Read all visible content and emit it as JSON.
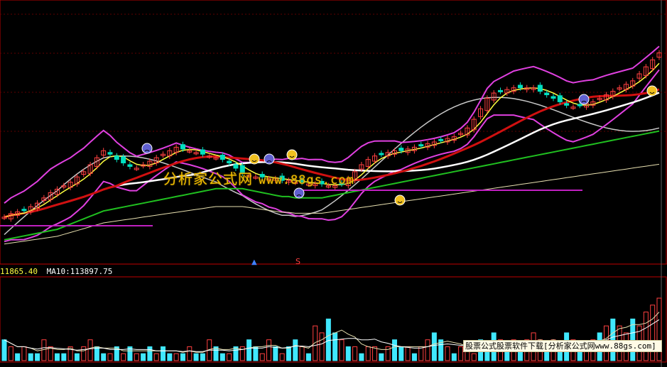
{
  "colors": {
    "background": "#000000",
    "panel_border": "#c00000",
    "up_candle": "#ff4040",
    "down_candle": "#00e0c0",
    "volume_up": "#ff4040",
    "volume_down": "#40e8ff",
    "ma_white": "#ffffff",
    "ma_yellow": "#ffff40",
    "ma_red": "#d01010",
    "ma_green": "#20c020",
    "ma_pale": "#e8e0b0",
    "band_magenta": "#e040e0",
    "band_gray": "#c8c8c8",
    "signal_line": "#c020c0"
  },
  "volume_header": {
    "ma5_text": "11865.40",
    "ma10_text": "MA10:113897.75",
    "ma5_color": "#ffff40",
    "ma10_color": "#ffffff"
  },
  "watermark": {
    "center_text": "分析家公式网",
    "center_url": "www.88gs.com",
    "footer_text": "股票公式股票软件下载[分析家公式网www.88gs.com]"
  },
  "signals": {
    "up_arrow_symbol": "▲",
    "s_mark": "S"
  },
  "icons": [
    "sad-face-icon",
    "smile-face-icon"
  ],
  "chart_data": [
    {
      "type": "candlestick",
      "title": "",
      "xlabel": "",
      "ylabel": "",
      "grid": true,
      "x": [
        1,
        2,
        3,
        4,
        5,
        6,
        7,
        8,
        9,
        10,
        11,
        12,
        13,
        14,
        15,
        16,
        17,
        18,
        19,
        20,
        21,
        22,
        23,
        24,
        25,
        26,
        27,
        28,
        29,
        30,
        31,
        32,
        33,
        34,
        35,
        36,
        37,
        38,
        39,
        40,
        41,
        42,
        43,
        44,
        45,
        46,
        47,
        48,
        49,
        50,
        51,
        52,
        53,
        54,
        55,
        56,
        57,
        58,
        59,
        60,
        61,
        62,
        63,
        64,
        65,
        66,
        67,
        68,
        69,
        70,
        71,
        72,
        73,
        74,
        75,
        76,
        77,
        78,
        79,
        80,
        81,
        82,
        83,
        84,
        85,
        86,
        87,
        88,
        89,
        90,
        91,
        92,
        93,
        94,
        95,
        96,
        97,
        98,
        99,
        100
      ],
      "close": [
        22,
        24,
        25,
        26,
        28,
        30,
        33,
        36,
        38,
        40,
        42,
        45,
        48,
        52,
        56,
        60,
        58,
        55,
        53,
        51,
        50,
        52,
        54,
        56,
        58,
        60,
        62,
        61,
        60,
        59,
        58,
        57,
        56,
        55,
        53,
        50,
        47,
        46,
        45,
        45,
        44,
        44,
        43,
        43,
        42,
        42,
        41,
        41,
        41,
        40,
        40,
        41,
        44,
        48,
        52,
        55,
        57,
        58,
        59,
        60,
        60,
        61,
        62,
        63,
        64,
        65,
        66,
        67,
        68,
        70,
        73,
        78,
        84,
        90,
        93,
        94,
        95,
        96,
        96,
        96,
        96,
        94,
        92,
        90,
        88,
        86,
        85,
        86,
        87,
        88,
        90,
        92,
        94,
        96,
        98,
        100,
        104,
        108,
        112,
        116
      ],
      "series": [
        {
          "name": "",
          "values": [
            12,
            13,
            14,
            15,
            16,
            17,
            18,
            19,
            20,
            22,
            24,
            26,
            28,
            30,
            32,
            34,
            35,
            36,
            37,
            38,
            39,
            40,
            41,
            42,
            43,
            44,
            45,
            46,
            47,
            48,
            49,
            50,
            51,
            51,
            51,
            51,
            51,
            50,
            49,
            48,
            47,
            46,
            45,
            45,
            44,
            44,
            44,
            44,
            44,
            45,
            46,
            47,
            48,
            49,
            50,
            51,
            52,
            53,
            54,
            55,
            56,
            57,
            58,
            59,
            60,
            61,
            62,
            63,
            64,
            65,
            66,
            67,
            68,
            69,
            70,
            71,
            72,
            73,
            74,
            75,
            76,
            77,
            78,
            79,
            80,
            81,
            82,
            83,
            84,
            85,
            86,
            87,
            88,
            89,
            90,
            91,
            92,
            93,
            94,
            95
          ]
        }
      ]
    },
    {
      "type": "bar",
      "title": "",
      "categories": [
        1,
        2,
        3,
        4,
        5,
        6,
        7,
        8,
        9,
        10,
        11,
        12,
        13,
        14,
        15,
        16,
        17,
        18,
        19,
        20,
        21,
        22,
        23,
        24,
        25,
        26,
        27,
        28,
        29,
        30,
        31,
        32,
        33,
        34,
        35,
        36,
        37,
        38,
        39,
        40,
        41,
        42,
        43,
        44,
        45,
        46,
        47,
        48,
        49,
        50,
        51,
        52,
        53,
        54,
        55,
        56,
        57,
        58,
        59,
        60,
        61,
        62,
        63,
        64,
        65,
        66,
        67,
        68,
        69,
        70,
        71,
        72,
        73,
        74,
        75,
        76,
        77,
        78,
        79,
        80,
        81,
        82,
        83,
        84,
        85,
        86,
        87,
        88,
        89,
        90,
        91,
        92,
        93,
        94,
        95,
        96,
        97,
        98,
        99,
        100
      ],
      "values": [
        3,
        2,
        1,
        2,
        1,
        1,
        3,
        2,
        1,
        1,
        2,
        1,
        2,
        3,
        2,
        1,
        1,
        2,
        1,
        2,
        1,
        1,
        2,
        1,
        2,
        1,
        1,
        1,
        2,
        1,
        1,
        3,
        2,
        1,
        1,
        2,
        2,
        3,
        2,
        1,
        3,
        2,
        1,
        2,
        3,
        2,
        1,
        5,
        4,
        6,
        4,
        3,
        2,
        2,
        1,
        2,
        2,
        1,
        2,
        3,
        2,
        2,
        1,
        2,
        3,
        4,
        3,
        2,
        1,
        2,
        2,
        1,
        3,
        2,
        4,
        3,
        2,
        3,
        2,
        3,
        4,
        3,
        2,
        3,
        2,
        4,
        3,
        2,
        2,
        3,
        4,
        5,
        6,
        5,
        4,
        6,
        5,
        7,
        8,
        9
      ],
      "up": [
        0,
        1,
        0,
        1,
        0,
        0,
        1,
        1,
        0,
        0,
        1,
        0,
        1,
        1,
        0,
        0,
        1,
        0,
        1,
        0,
        1,
        0,
        0,
        1,
        0,
        0,
        1,
        0,
        1,
        0,
        0,
        1,
        0,
        0,
        1,
        0,
        1,
        0,
        0,
        1,
        1,
        0,
        1,
        0,
        0,
        1,
        0,
        1,
        1,
        0,
        0,
        1,
        0,
        1,
        0,
        1,
        1,
        0,
        1,
        0,
        0,
        1,
        0,
        1,
        1,
        0,
        0,
        1,
        0,
        1,
        1,
        1,
        0,
        0,
        0,
        1,
        0,
        1,
        0,
        1,
        1,
        1,
        0,
        1,
        0,
        0,
        1,
        0,
        1,
        1,
        0,
        1,
        0,
        1,
        1,
        0,
        1,
        1,
        1,
        1
      ]
    }
  ]
}
